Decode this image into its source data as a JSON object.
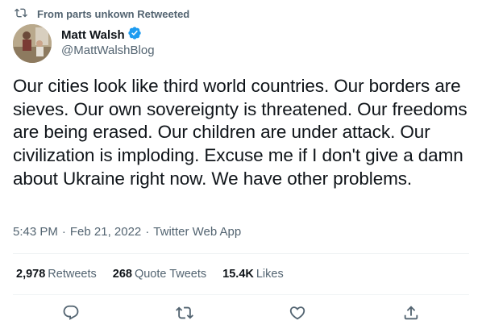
{
  "retweet_context": {
    "icon": "retweet-icon",
    "label": "From parts unkown Retweeted"
  },
  "author": {
    "name": "Matt Walsh",
    "verified": true,
    "handle": "@MattWalshBlog"
  },
  "tweet": {
    "text": "Our cities look like third world countries. Our borders are sieves. Our own sovereignty is threatened. Our freedoms are being erased. Our children are under attack. Our civilization is imploding. Excuse me if I don't give a damn about Ukraine right now. We have other problems.",
    "time": "5:43 PM",
    "date": "Feb 21, 2022",
    "source": "Twitter Web App"
  },
  "stats": {
    "retweets_count": "2,978",
    "retweets_label": "Retweets",
    "quotes_count": "268",
    "quotes_label": "Quote Tweets",
    "likes_count": "15.4K",
    "likes_label": "Likes"
  },
  "actions": [
    "reply-icon",
    "retweet-icon",
    "like-icon",
    "share-icon"
  ],
  "colors": {
    "text": "#0f1419",
    "secondary": "#536471",
    "verified": "#1d9bf0",
    "divider": "#eff3f4"
  }
}
